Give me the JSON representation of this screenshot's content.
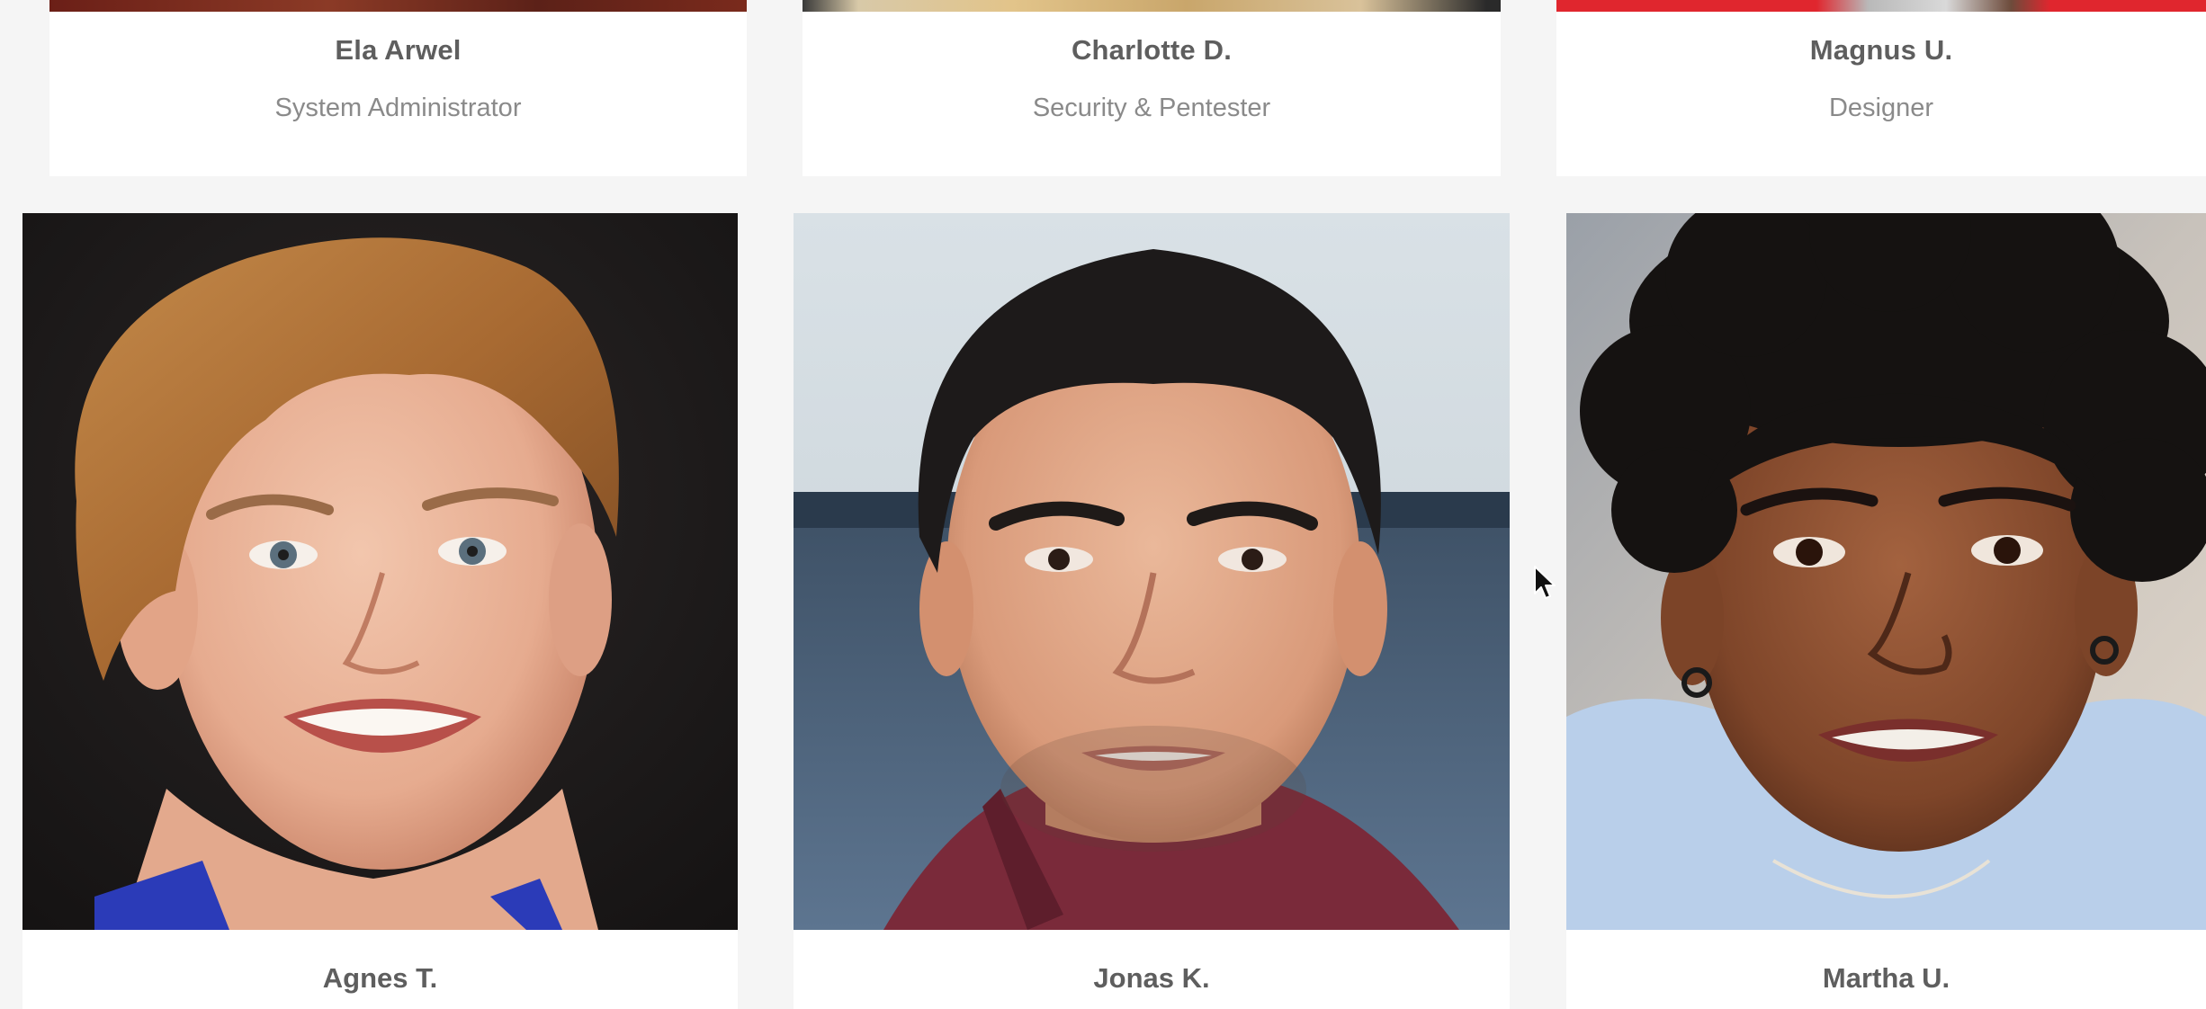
{
  "colors": {
    "page_background": "#f5f5f5",
    "card_background": "#ffffff",
    "name_text": "#5e5e5e",
    "role_text": "#8a8a8a"
  },
  "top_row": [
    {
      "name": "Ela Arwel",
      "role": "System Administrator",
      "photo_strip_color": "#7a2a1c"
    },
    {
      "name": "Charlotte D.",
      "role": "Security & Pentester",
      "photo_strip_color": "#c9a66b"
    },
    {
      "name": "Magnus U.",
      "role": "Designer",
      "photo_strip_color": "#e0262e"
    }
  ],
  "bottom_row": [
    {
      "name": "Agnes T.",
      "photo_icon": "portrait-woman-short-blonde-hair"
    },
    {
      "name": "Jonas K.",
      "photo_icon": "portrait-man-dark-hair"
    },
    {
      "name": "Martha U.",
      "photo_icon": "portrait-woman-curly-hair"
    }
  ],
  "cursor_icon": "mouse-pointer-icon"
}
